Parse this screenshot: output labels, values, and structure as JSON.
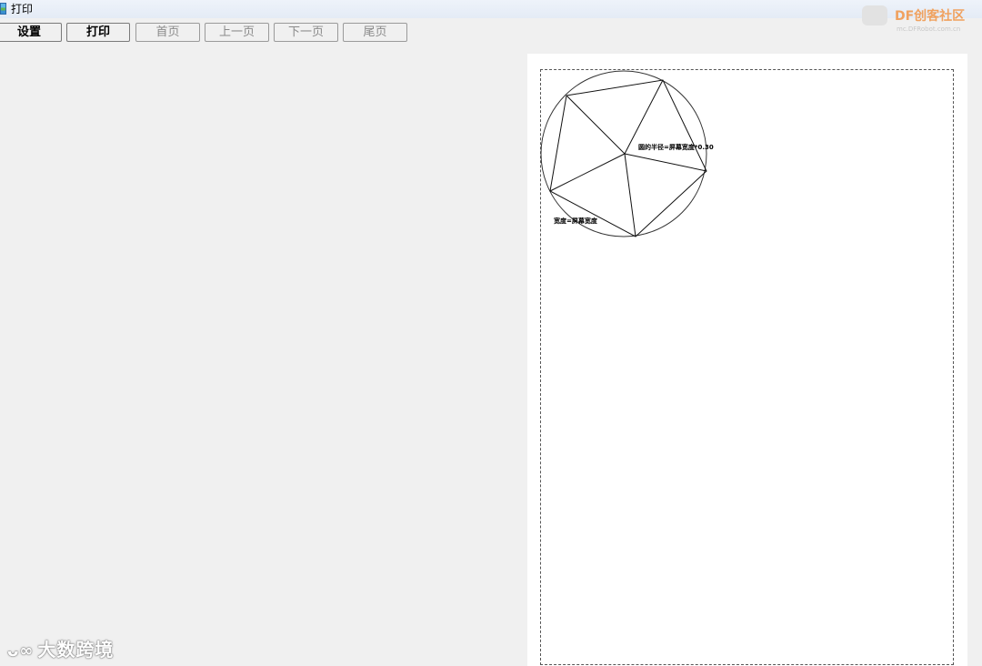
{
  "window": {
    "title": "打印"
  },
  "toolbar": {
    "buttons": [
      {
        "label": "设置",
        "enabled": true
      },
      {
        "label": "打印",
        "enabled": true
      },
      {
        "label": "首页",
        "enabled": false
      },
      {
        "label": "上一页",
        "enabled": false
      },
      {
        "label": "下一页",
        "enabled": false
      },
      {
        "label": "尾页",
        "enabled": false
      }
    ]
  },
  "preview": {
    "label_radius": "圆的半径=屏幕宽度*0.30",
    "label_width": "宽度=屏幕宽度"
  },
  "watermarks": {
    "bottom_left": "大数跨境",
    "top_right_brand": "DF创客社区",
    "top_right_url": "mc.DFRobot.com.cn"
  }
}
